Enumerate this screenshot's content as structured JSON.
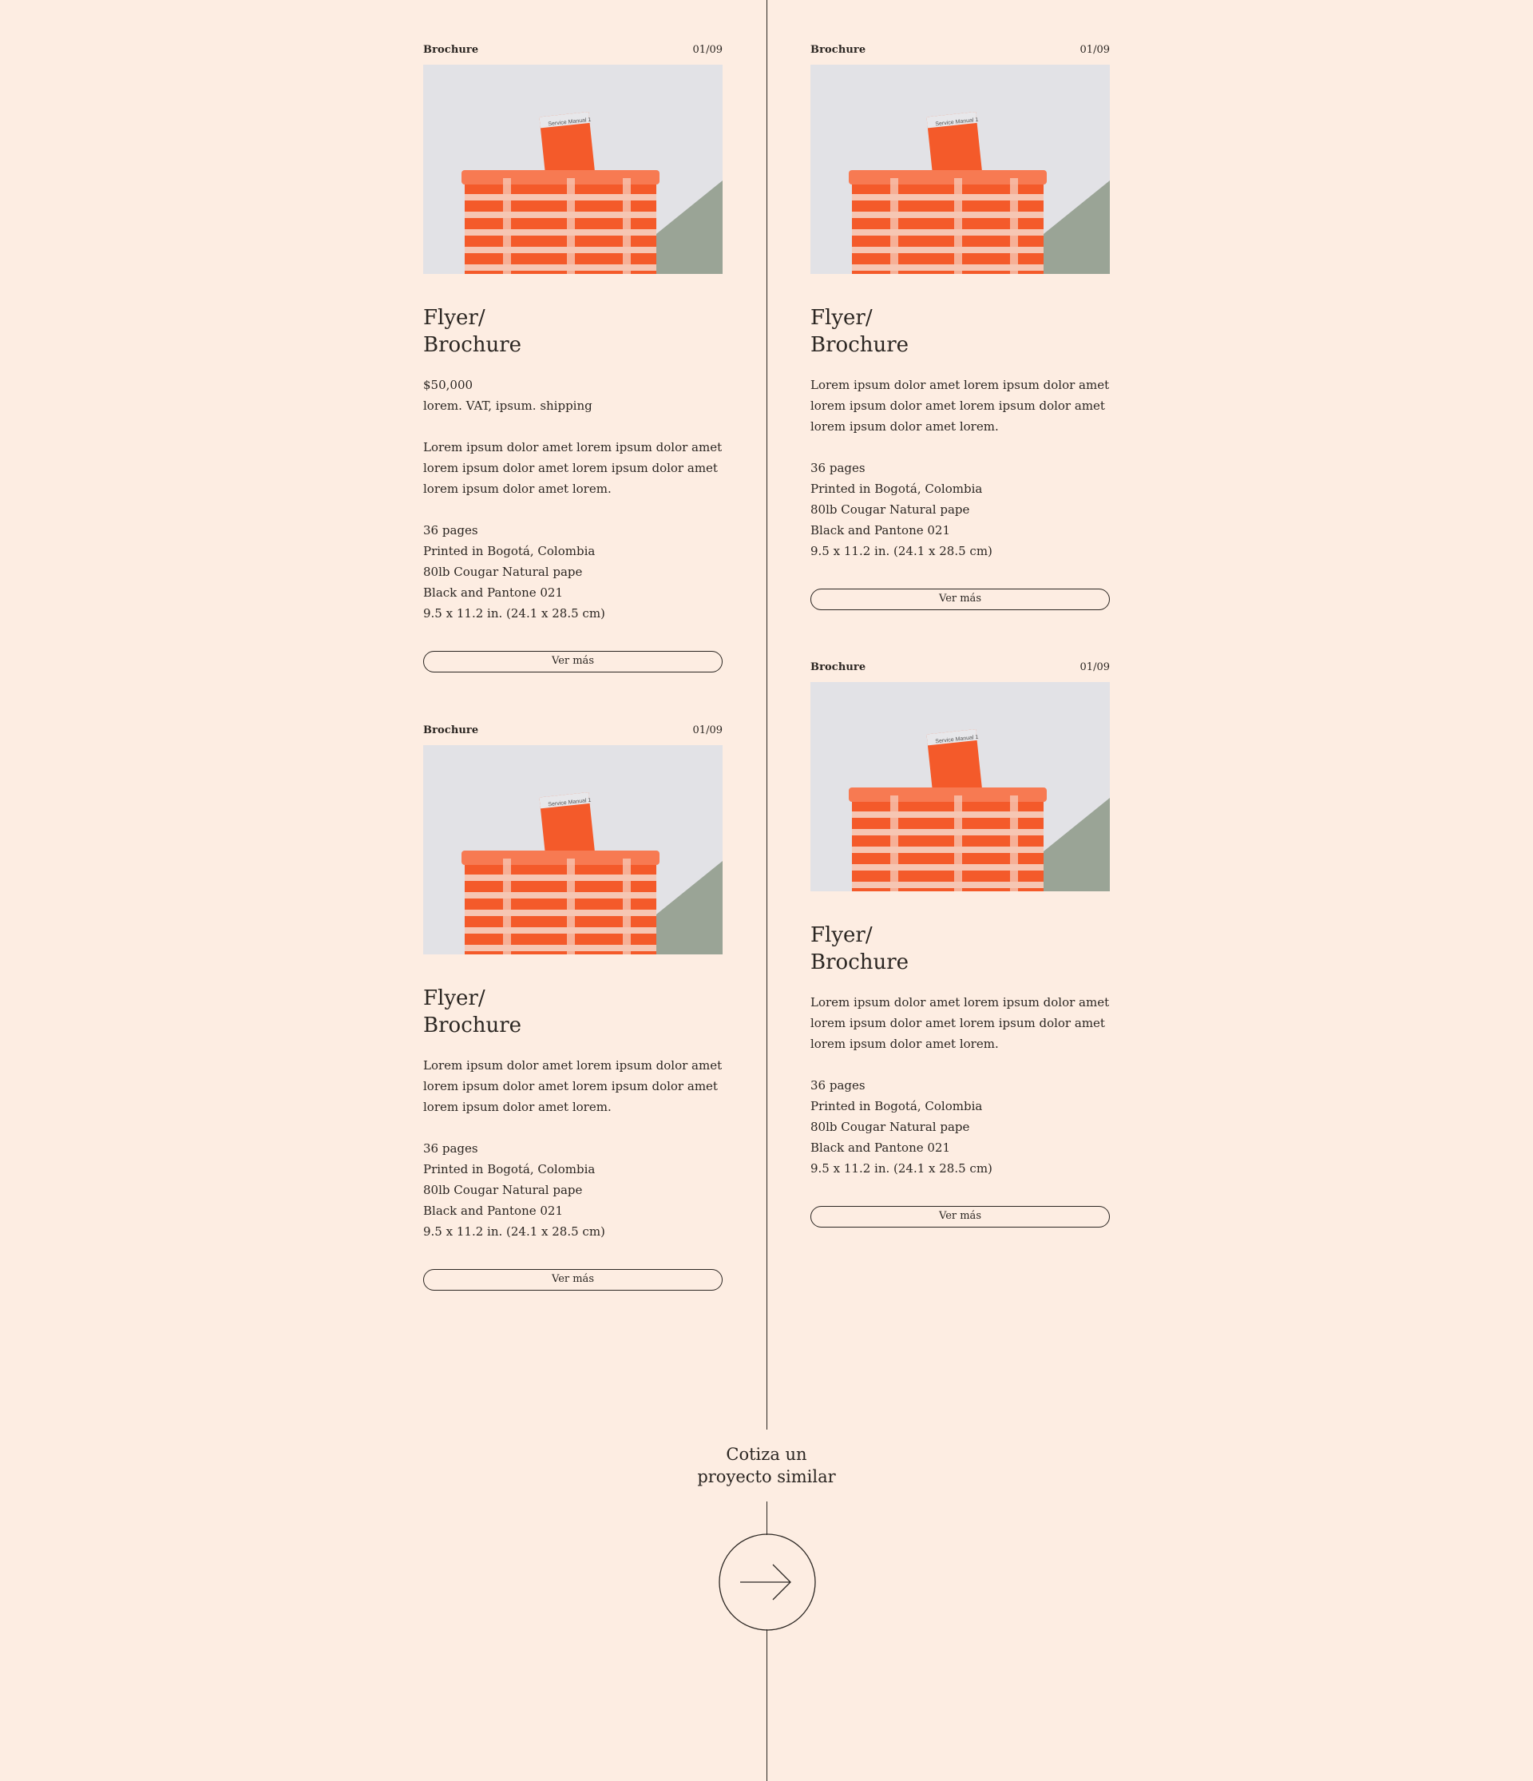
{
  "colors": {
    "background": "#fdede2",
    "ink": "#2b2622",
    "product_orange": "#f45a2a"
  },
  "cards": [
    {
      "category": "Brochure",
      "counter": "01/09",
      "photo_label": "Service Manual 1",
      "title_line1": "Flyer/",
      "title_line2": "Brochure",
      "price": "$50,000",
      "price_note": "lorem. VAT, ipsum. shipping",
      "description": [
        "Lorem ipsum dolor amet lorem ipsum dolor amet",
        "lorem ipsum dolor amet lorem ipsum dolor amet",
        "lorem ipsum dolor amet lorem."
      ],
      "specs": [
        "36 pages",
        "Printed in Bogotá, Colombia",
        "80lb Cougar Natural pape",
        "Black and Pantone 021",
        "9.5 x 11.2 in. (24.1 x 28.5 cm)"
      ],
      "button": "Ver más"
    },
    {
      "category": "Brochure",
      "counter": "01/09",
      "photo_label": "Service Manual 1",
      "title_line1": "Flyer/",
      "title_line2": "Brochure",
      "description": [
        "Lorem ipsum dolor amet lorem ipsum dolor amet",
        "lorem ipsum dolor amet lorem ipsum dolor amet",
        "lorem ipsum dolor amet lorem."
      ],
      "specs": [
        "36 pages",
        "Printed in Bogotá, Colombia",
        "80lb Cougar Natural pape",
        "Black and Pantone 021",
        "9.5 x 11.2 in. (24.1 x 28.5 cm)"
      ],
      "button": "Ver más"
    },
    {
      "category": "Brochure",
      "counter": "01/09",
      "photo_label": "Service Manual 1",
      "title_line1": "Flyer/",
      "title_line2": "Brochure",
      "description": [
        "Lorem ipsum dolor amet lorem ipsum dolor amet",
        "lorem ipsum dolor amet lorem ipsum dolor amet",
        "lorem ipsum dolor amet lorem."
      ],
      "specs": [
        "36 pages",
        "Printed in Bogotá, Colombia",
        "80lb Cougar Natural pape",
        "Black and Pantone 021",
        "9.5 x 11.2 in. (24.1 x 28.5 cm)"
      ],
      "button": "Ver más"
    },
    {
      "category": "Brochure",
      "counter": "01/09",
      "photo_label": "Service Manual 1",
      "title_line1": "Flyer/",
      "title_line2": "Brochure",
      "description": [
        "Lorem ipsum dolor amet lorem ipsum dolor amet",
        "lorem ipsum dolor amet lorem ipsum dolor amet",
        "lorem ipsum dolor amet lorem."
      ],
      "specs": [
        "36 pages",
        "Printed in Bogotá, Colombia",
        "80lb Cougar Natural pape",
        "Black and Pantone 021",
        "9.5 x 11.2 in. (24.1 x 28.5 cm)"
      ],
      "button": "Ver más"
    }
  ],
  "cta": {
    "line1": "Cotiza un",
    "line2": "proyecto similar",
    "icon": "arrow-right-icon"
  }
}
